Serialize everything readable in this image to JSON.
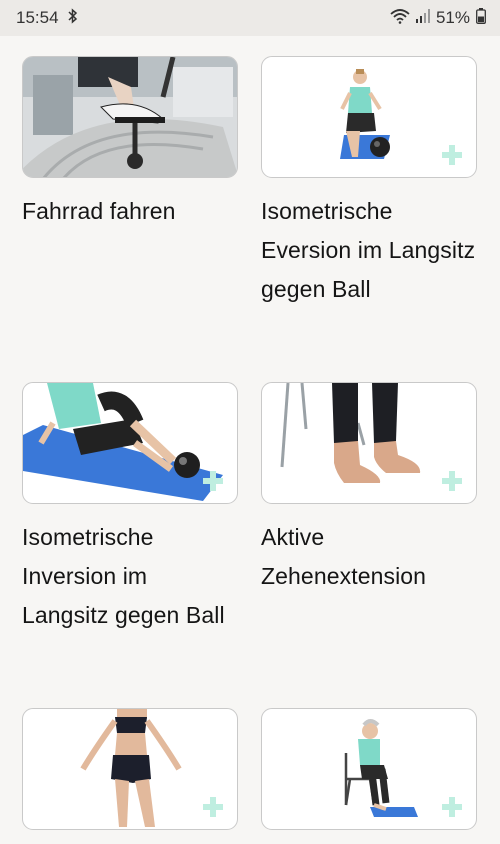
{
  "status_bar": {
    "time": "15:54",
    "battery": "51%",
    "icons": [
      "bluetooth-icon",
      "wifi-icon",
      "signal-icon",
      "battery-icon"
    ]
  },
  "exercises": [
    {
      "title": "Fahrrad fahren",
      "thumbnail": "stationary-bike-pedal-image"
    },
    {
      "title": "Isometrische Eversion im Langsitz gegen Ball",
      "thumbnail": "seated-eversion-ball-image",
      "badge_icon": "plus-icon"
    },
    {
      "title": "Isometrische Inversion im Langsitz gegen Ball",
      "thumbnail": "seated-inversion-ball-image",
      "badge_icon": "plus-icon"
    },
    {
      "title": "Aktive Zehenextension",
      "thumbnail": "toe-extension-feet-image",
      "badge_icon": "plus-icon"
    },
    {
      "title": "",
      "thumbnail": "standing-woman-image",
      "badge_icon": "plus-icon"
    },
    {
      "title": "",
      "thumbnail": "seated-chair-exercise-image",
      "badge_icon": "plus-icon"
    }
  ],
  "colors": {
    "background": "#f7f6f4",
    "status_bar": "#eceae7",
    "plus_badge": "#bfeee0",
    "mat_blue": "#3a78d8",
    "shirt_teal": "#7fd9c8"
  }
}
